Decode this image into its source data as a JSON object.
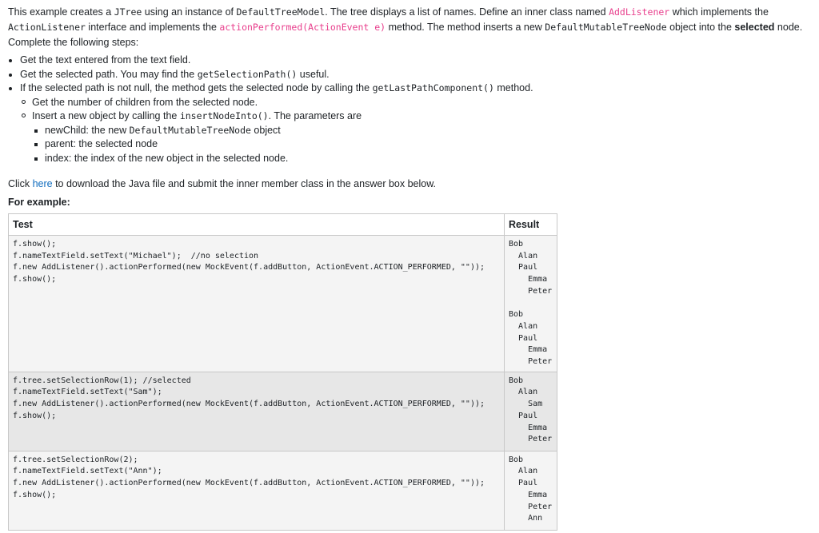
{
  "intro": {
    "p1": "This example creates a ",
    "c1": "JTree",
    "p2": " using an instance of ",
    "c2": "DefaultTreeModel",
    "p3": ". The tree displays a list of names. Define an inner class named ",
    "c3": "AddListener",
    "p4": " which implements the ",
    "c4": "ActionListener",
    "p5": " interface and implements the ",
    "c5": "actionPerformed(ActionEvent e)",
    "p6": " method. The method inserts a new ",
    "c6": "DefaultMutableTreeNode",
    "p7": " object into the ",
    "b1": "selected",
    "p8": " node. Complete the following steps:"
  },
  "steps": {
    "s1": "Get the text entered from the text field.",
    "s2a": "Get the selected path. You may find the ",
    "s2c": "getSelectionPath()",
    "s2b": " useful.",
    "s3a": "If the selected path is not null, the method gets the selected node by calling the ",
    "s3c": "getLastPathComponent()",
    "s3b": " method.",
    "s3_1": "Get the number of children from the selected node.",
    "s3_2a": "Insert a new object by calling the ",
    "s3_2c": "insertNodeInto()",
    "s3_2b": ". The parameters are",
    "p_new_a": "newChild: the new ",
    "p_new_c": "DefaultMutableTreeNode",
    "p_new_b": " object",
    "p_parent": "parent: the selected node",
    "p_index": "index: the index of the new object in the selected node."
  },
  "download": {
    "before": "Click ",
    "link": "here",
    "after": " to download the Java file and submit the inner member class in the answer box below."
  },
  "for_example": "For example:",
  "table": {
    "headers": {
      "test": "Test",
      "result": "Result"
    },
    "rows": [
      {
        "test": "f.show();\nf.nameTextField.setText(\"Michael\");  //no selection\nf.new AddListener().actionPerformed(new MockEvent(f.addButton, ActionEvent.ACTION_PERFORMED, \"\"));\nf.show();",
        "result": "Bob\n  Alan\n  Paul\n    Emma\n    Peter\n\nBob\n  Alan\n  Paul\n    Emma\n    Peter"
      },
      {
        "test": "f.tree.setSelectionRow(1); //selected\nf.nameTextField.setText(\"Sam\");\nf.new AddListener().actionPerformed(new MockEvent(f.addButton, ActionEvent.ACTION_PERFORMED, \"\"));\nf.show();",
        "result": "Bob\n  Alan\n    Sam\n  Paul\n    Emma\n    Peter"
      },
      {
        "test": "f.tree.setSelectionRow(2);\nf.nameTextField.setText(\"Ann\");\nf.new AddListener().actionPerformed(new MockEvent(f.addButton, ActionEvent.ACTION_PERFORMED, \"\"));\nf.show();",
        "result": "Bob\n  Alan\n  Paul\n    Emma\n    Peter\n    Ann"
      }
    ]
  },
  "colors": {
    "code_accent": "#e83e8c",
    "link": "#0f6cbf"
  }
}
